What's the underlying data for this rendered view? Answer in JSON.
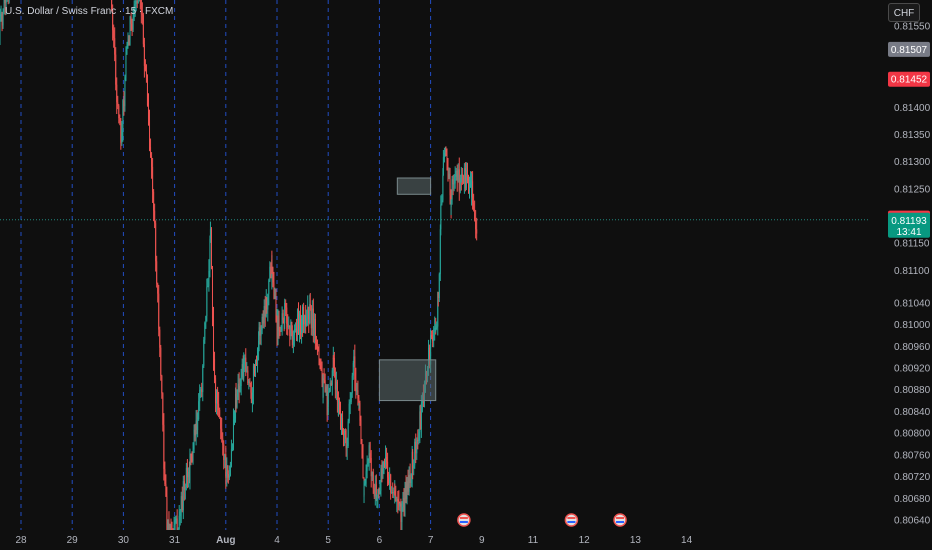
{
  "header": {
    "title": "U.S. Dollar / Swiss Franc · 15 · FXCM",
    "currency_button": "CHF"
  },
  "colors": {
    "background": "#0f0f0f",
    "up": "#26a69a",
    "down": "#ef5350",
    "session_line": "#2962ff",
    "zone_fill": "#5d6b6e",
    "label_gray": "#787b86",
    "label_red": "#f23645",
    "label_green": "#089981",
    "dotted_price": "#26a69a"
  },
  "chart_data": {
    "type": "candlestick",
    "y_ticks": [
      "0.81550",
      "0.81400",
      "0.81350",
      "0.81300",
      "0.81250",
      "0.81150",
      "0.81100",
      "0.81040",
      "0.81000",
      "0.80960",
      "0.80920",
      "0.80880",
      "0.80840",
      "0.80800",
      "0.80760",
      "0.80720",
      "0.80680",
      "0.80640"
    ],
    "y_tick_values": [
      0.8155,
      0.814,
      0.8135,
      0.813,
      0.8125,
      0.8115,
      0.811,
      0.8104,
      0.81,
      0.8096,
      0.8092,
      0.8088,
      0.8084,
      0.808,
      0.8076,
      0.8072,
      0.8068,
      0.8064
    ],
    "x_ticks": [
      "28",
      "29",
      "30",
      "31",
      "Aug",
      "4",
      "5",
      "6",
      "7",
      "9",
      "11",
      "12",
      "13",
      "14"
    ],
    "session_dates": [
      "28",
      "29",
      "30",
      "31",
      "Aug",
      "4",
      "5",
      "6",
      "7"
    ],
    "price_labels": [
      {
        "text": "0.81507",
        "value": 0.81507,
        "style": "gray"
      },
      {
        "text": "0.81452",
        "value": 0.81452,
        "style": "red"
      },
      {
        "text": "0.81196",
        "value": 0.81196,
        "style": "red"
      }
    ],
    "current_price": {
      "price": "0.81193",
      "countdown": "13:41",
      "value": 0.81193
    },
    "zones": [
      {
        "name": "upper-zone",
        "x_start": 7.35,
        "x_end": 8.0,
        "y_low": 0.8124,
        "y_high": 0.8127
      },
      {
        "name": "lower-zone",
        "x_start": 7.0,
        "x_end": 8.1,
        "y_low": 0.8086,
        "y_high": 0.80935
      }
    ],
    "events": [
      {
        "name": "flag-event-1",
        "icon": "flag-icon",
        "x": 8.65
      },
      {
        "name": "flag-event-2",
        "icon": "flag-icon",
        "x": 10.75
      },
      {
        "name": "flag-event-3",
        "icon": "flag-icon",
        "x": 11.7
      }
    ],
    "series": [
      {
        "x": -0.45,
        "y": 0.8152
      },
      {
        "x": -0.35,
        "y": 0.8159
      },
      {
        "x": -0.2,
        "y": 0.8165
      },
      {
        "x": 1.75,
        "y": 0.8163
      },
      {
        "x": 1.85,
        "y": 0.8145
      },
      {
        "x": 1.95,
        "y": 0.8133
      },
      {
        "x": 2.05,
        "y": 0.8148
      },
      {
        "x": 2.15,
        "y": 0.8156
      },
      {
        "x": 2.25,
        "y": 0.816
      },
      {
        "x": 2.35,
        "y": 0.8157
      },
      {
        "x": 2.45,
        "y": 0.8145
      },
      {
        "x": 2.55,
        "y": 0.8128
      },
      {
        "x": 2.65,
        "y": 0.811
      },
      {
        "x": 2.75,
        "y": 0.8085
      },
      {
        "x": 2.85,
        "y": 0.8062
      },
      {
        "x": 3.05,
        "y": 0.8062
      },
      {
        "x": 3.15,
        "y": 0.8068
      },
      {
        "x": 3.3,
        "y": 0.8074
      },
      {
        "x": 3.45,
        "y": 0.8082
      },
      {
        "x": 3.55,
        "y": 0.8092
      },
      {
        "x": 3.65,
        "y": 0.8108
      },
      {
        "x": 3.7,
        "y": 0.8118
      },
      {
        "x": 3.78,
        "y": 0.8088
      },
      {
        "x": 3.9,
        "y": 0.8081
      },
      {
        "x": 4.05,
        "y": 0.807
      },
      {
        "x": 4.2,
        "y": 0.8087
      },
      {
        "x": 4.35,
        "y": 0.8092
      },
      {
        "x": 4.5,
        "y": 0.8088
      },
      {
        "x": 4.65,
        "y": 0.8098
      },
      {
        "x": 4.8,
        "y": 0.8105
      },
      {
        "x": 4.9,
        "y": 0.8112
      },
      {
        "x": 5.0,
        "y": 0.81
      },
      {
        "x": 5.15,
        "y": 0.8102
      },
      {
        "x": 5.3,
        "y": 0.8098
      },
      {
        "x": 5.5,
        "y": 0.8101
      },
      {
        "x": 5.65,
        "y": 0.8102
      },
      {
        "x": 5.8,
        "y": 0.8097
      },
      {
        "x": 5.9,
        "y": 0.8088
      },
      {
        "x": 6.0,
        "y": 0.8085
      },
      {
        "x": 6.1,
        "y": 0.8092
      },
      {
        "x": 6.2,
        "y": 0.8085
      },
      {
        "x": 6.35,
        "y": 0.8078
      },
      {
        "x": 6.5,
        "y": 0.8092
      },
      {
        "x": 6.6,
        "y": 0.8085
      },
      {
        "x": 6.7,
        "y": 0.807
      },
      {
        "x": 6.8,
        "y": 0.8075
      },
      {
        "x": 6.95,
        "y": 0.8068
      },
      {
        "x": 7.1,
        "y": 0.8075
      },
      {
        "x": 7.3,
        "y": 0.8068
      },
      {
        "x": 7.4,
        "y": 0.8065
      },
      {
        "x": 7.5,
        "y": 0.8068
      },
      {
        "x": 7.65,
        "y": 0.8075
      },
      {
        "x": 7.8,
        "y": 0.8082
      },
      {
        "x": 7.9,
        "y": 0.809
      },
      {
        "x": 8.0,
        "y": 0.8096
      },
      {
        "x": 8.1,
        "y": 0.81
      },
      {
        "x": 8.15,
        "y": 0.8105
      },
      {
        "x": 8.2,
        "y": 0.812
      },
      {
        "x": 8.25,
        "y": 0.8132
      },
      {
        "x": 8.3,
        "y": 0.813
      },
      {
        "x": 8.4,
        "y": 0.8124
      },
      {
        "x": 8.5,
        "y": 0.8128
      },
      {
        "x": 8.6,
        "y": 0.8126
      },
      {
        "x": 8.7,
        "y": 0.8128
      },
      {
        "x": 8.8,
        "y": 0.8124
      },
      {
        "x": 8.9,
        "y": 0.8119
      }
    ]
  }
}
